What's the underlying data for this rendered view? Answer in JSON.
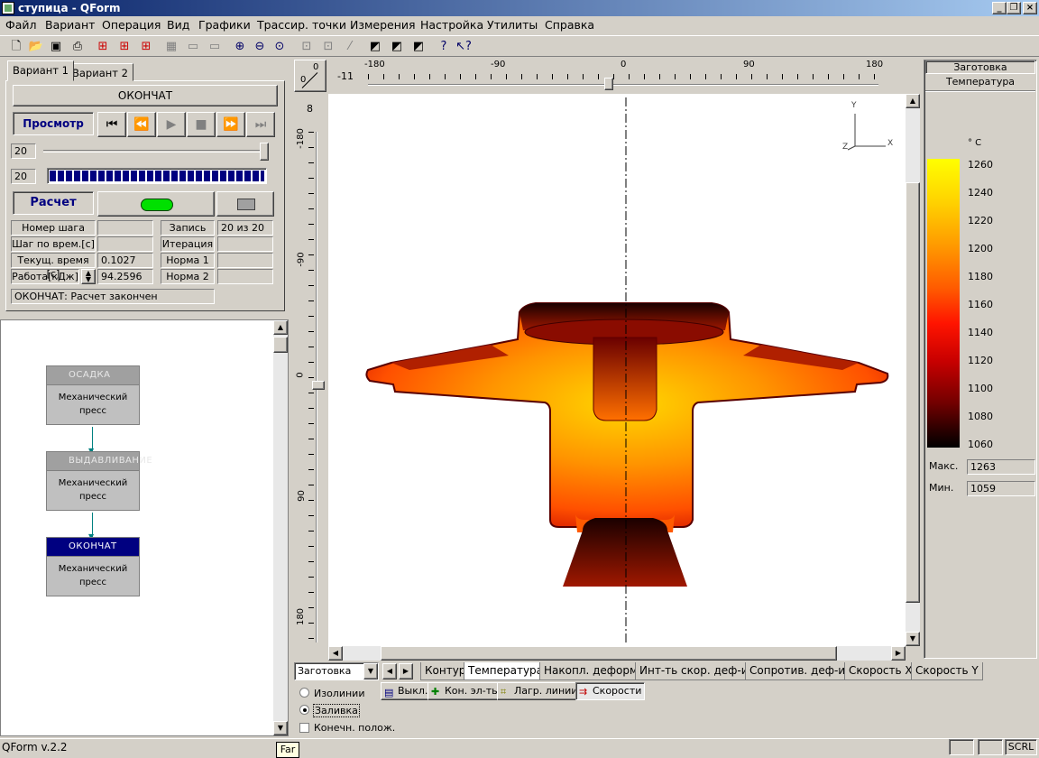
{
  "window": {
    "title": "ступица - QForm"
  },
  "menu": [
    "Файл",
    "Вариант",
    "Операция",
    "Вид",
    "Графики",
    "Трассир. точки",
    "Измерения",
    "Настройка",
    "Утилиты",
    "Справка"
  ],
  "tabs": [
    "Вариант 1",
    "Вариант 2"
  ],
  "sim": {
    "op_name": "ОКОНЧАТ",
    "view_label": "Просмотр",
    "calc_label": "Расчет",
    "slider_value": "20",
    "step_value": "20",
    "progress": 1.0
  },
  "fields": {
    "step_num": "Номер шага",
    "time_step": "Шаг по врем.[с]",
    "cur_time": "Текущ. время [с]",
    "cur_time_val": "0.1027",
    "work": "Работа[кДж]",
    "work_val": "94.2596",
    "record": "Запись",
    "record_val": "20 из 20",
    "iteration": "Итерация",
    "norm1": "Норма 1",
    "norm2": "Норма 2"
  },
  "status_msg": "ОКОНЧАТ: Расчет закончен",
  "tree": [
    {
      "title": "ОСАДКА",
      "device": "Механический пресс",
      "active": false
    },
    {
      "title": "ВЫДАВЛИВАНИЕ",
      "device": "Механический пресс",
      "active": false
    },
    {
      "title": "ОКОНЧАТ",
      "device": "Механический пресс",
      "active": true
    }
  ],
  "ruler": {
    "corner_top": "0",
    "corner_bot": "0",
    "h_offset": "-11",
    "v_offset": "8",
    "h_ticks": [
      "-180",
      "-90",
      "0",
      "90",
      "180"
    ],
    "v_ticks": [
      "-180",
      "-90",
      "0",
      "90",
      "180"
    ]
  },
  "axes": {
    "y": "Y",
    "x": "X",
    "z": "Z"
  },
  "legend": {
    "object": "Заготовка",
    "field": "Температура",
    "unit": "° C",
    "ticks": [
      "1260",
      "1240",
      "1220",
      "1200",
      "1180",
      "1160",
      "1140",
      "1120",
      "1100",
      "1080",
      "1060"
    ],
    "max_label": "Макс.",
    "max": "1263",
    "min_label": "Мин.",
    "min": "1059"
  },
  "bottom": {
    "object_select": "Заготовка",
    "tabs": [
      "Контур",
      "Температура",
      "Накопл. деформ.",
      "Инт-ть скор. деф-ии",
      "Сопротив. деф-ии",
      "Скорость X",
      "Скорость Y"
    ],
    "buttons": [
      "Выкл.",
      "Кон. эл-ты",
      "Лагр. линии",
      "Скорости"
    ],
    "radio1": "Изолинии",
    "radio2": "Заливка",
    "check": "Конечн. полож."
  },
  "statusbar": {
    "version": "QForm v.2.2",
    "tooltip": "Far",
    "scrl": "SCRL"
  }
}
